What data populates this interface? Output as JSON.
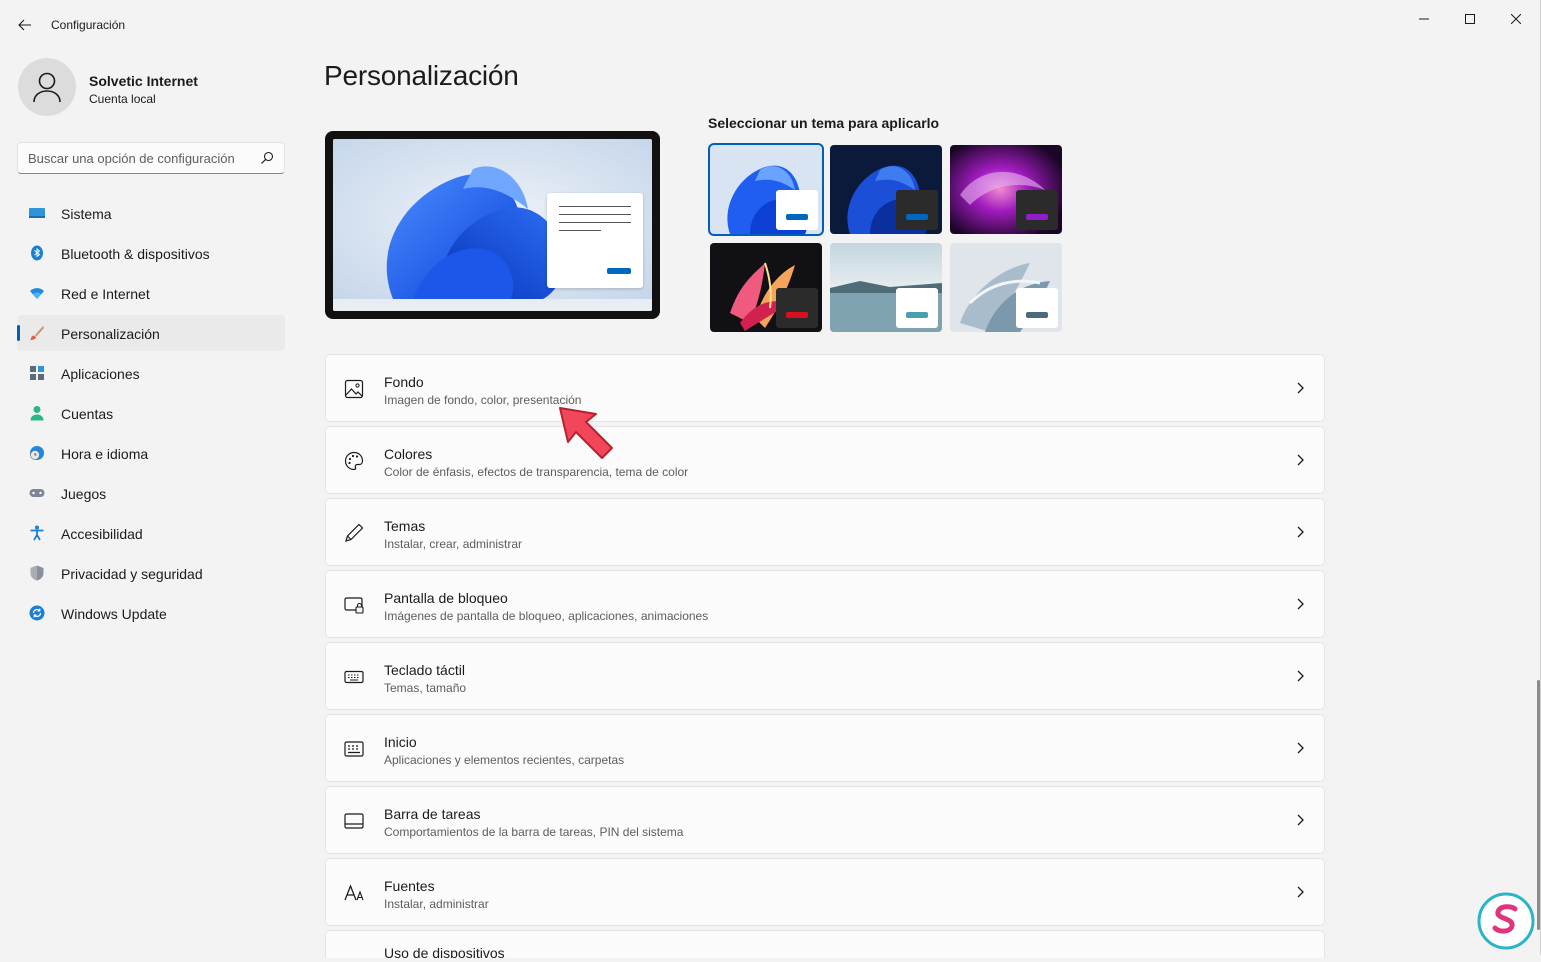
{
  "window": {
    "title": "Configuración"
  },
  "user": {
    "name": "Solvetic Internet",
    "account_type": "Cuenta local"
  },
  "search": {
    "placeholder": "Buscar una opción de configuración"
  },
  "sidebar": {
    "items": [
      {
        "label": "Sistema",
        "icon": "monitor-icon",
        "active": false
      },
      {
        "label": "Bluetooth & dispositivos",
        "icon": "bluetooth-icon",
        "active": false
      },
      {
        "label": "Red e Internet",
        "icon": "wifi-icon",
        "active": false
      },
      {
        "label": "Personalización",
        "icon": "brush-icon",
        "active": true
      },
      {
        "label": "Aplicaciones",
        "icon": "apps-icon",
        "active": false
      },
      {
        "label": "Cuentas",
        "icon": "person-icon",
        "active": false
      },
      {
        "label": "Hora e idioma",
        "icon": "clock-globe-icon",
        "active": false
      },
      {
        "label": "Juegos",
        "icon": "gamepad-icon",
        "active": false
      },
      {
        "label": "Accesibilidad",
        "icon": "accessibility-icon",
        "active": false
      },
      {
        "label": "Privacidad y seguridad",
        "icon": "shield-icon",
        "active": false
      },
      {
        "label": "Windows Update",
        "icon": "update-icon",
        "active": false
      }
    ]
  },
  "main": {
    "title": "Personalización",
    "themes_label": "Seleccionar un tema para aplicarlo",
    "themes": [
      {
        "name": "theme-light-bloom",
        "selected": true,
        "accent": "#0067c0"
      },
      {
        "name": "theme-dark-bloom",
        "selected": false,
        "accent": "#0067c0"
      },
      {
        "name": "theme-glow",
        "selected": false,
        "accent": "#8e1ec8"
      },
      {
        "name": "theme-captured-motion",
        "selected": false,
        "accent": "#d6101e"
      },
      {
        "name": "theme-sunrise",
        "selected": false,
        "accent": "#4aa0ae"
      },
      {
        "name": "theme-flow",
        "selected": false,
        "accent": "#4b6a7c"
      }
    ],
    "settings": [
      {
        "title": "Fondo",
        "subtitle": "Imagen de fondo, color, presentación",
        "icon": "image-icon"
      },
      {
        "title": "Colores",
        "subtitle": "Color de énfasis, efectos de transparencia, tema de color",
        "icon": "palette-icon"
      },
      {
        "title": "Temas",
        "subtitle": "Instalar, crear, administrar",
        "icon": "pen-icon"
      },
      {
        "title": "Pantalla de bloqueo",
        "subtitle": "Imágenes de pantalla de bloqueo, aplicaciones, animaciones",
        "icon": "lock-screen-icon"
      },
      {
        "title": "Teclado táctil",
        "subtitle": "Temas, tamaño",
        "icon": "keyboard-icon"
      },
      {
        "title": "Inicio",
        "subtitle": "Aplicaciones y elementos recientes, carpetas",
        "icon": "start-menu-icon"
      },
      {
        "title": "Barra de tareas",
        "subtitle": "Comportamientos de la barra de tareas, PIN del sistema",
        "icon": "taskbar-icon"
      },
      {
        "title": "Fuentes",
        "subtitle": "Instalar, administrar",
        "icon": "font-icon"
      },
      {
        "title": "Uso de dispositivos",
        "subtitle": "",
        "icon": "device-usage-icon"
      }
    ]
  },
  "colors": {
    "accent": "#005fb8",
    "background": "#f3f3f3",
    "card": "#fbfbfb"
  }
}
